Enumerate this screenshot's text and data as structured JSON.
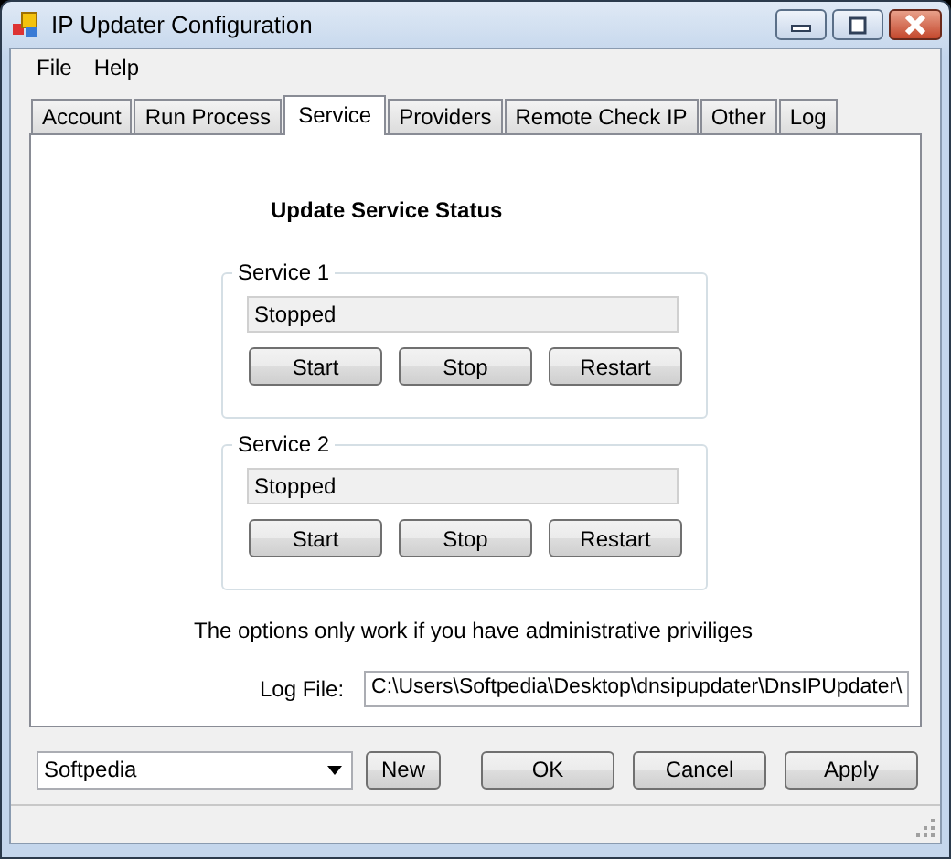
{
  "window": {
    "title": "IP Updater Configuration"
  },
  "menu": [
    "File",
    "Help"
  ],
  "tabs": [
    {
      "label": "Account",
      "selected": false
    },
    {
      "label": "Run Process",
      "selected": false
    },
    {
      "label": "Service",
      "selected": true
    },
    {
      "label": "Providers",
      "selected": false
    },
    {
      "label": "Remote Check IP",
      "selected": false
    },
    {
      "label": "Other",
      "selected": false
    },
    {
      "label": "Log",
      "selected": false
    }
  ],
  "service_panel": {
    "heading": "Update Service Status",
    "services": [
      {
        "label": "Service 1",
        "status": "Stopped",
        "buttons": [
          "Start",
          "Stop",
          "Restart"
        ]
      },
      {
        "label": "Service 2",
        "status": "Stopped",
        "buttons": [
          "Start",
          "Stop",
          "Restart"
        ]
      }
    ],
    "note": "The options only work if you have administrative priviliges",
    "log_file": {
      "label": "Log File:",
      "value": "C:\\Users\\Softpedia\\Desktop\\dnsipupdater\\DnsIPUpdater\\"
    }
  },
  "profile": {
    "value": "Softpedia"
  },
  "new_button": "New",
  "buttons": [
    "OK",
    "Cancel",
    "Apply"
  ]
}
